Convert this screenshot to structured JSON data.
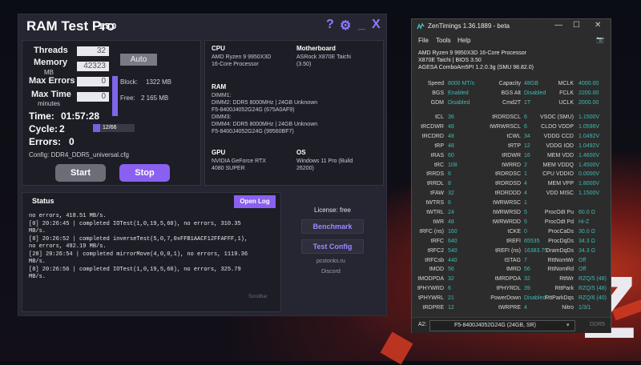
{
  "rtp": {
    "title": "RAM Test Pro",
    "version": "1.5.0",
    "controls": {
      "help": "?",
      "settings": "⚙",
      "minimize": "_",
      "close": "X"
    },
    "threads_label": "Threads",
    "threads_value": "32",
    "memory_label": "Memory",
    "memory_unit": "MB",
    "memory_value": "42323",
    "auto_label": "Auto",
    "max_errors_label": "Max Errors",
    "max_errors_value": "0",
    "max_time_label": "Max Time",
    "max_time_unit": "minutes",
    "max_time_value": "0",
    "block_label": "Block:",
    "block_value": "1322 MB",
    "free_label": "Free:",
    "free_value": "2 165 MB",
    "time_label": "Time:",
    "time_value": "01:57:28",
    "cycle_label": "Cycle:",
    "cycle_value": "2",
    "progress_text": "12/66",
    "progress_fraction": 0.18,
    "errors_label": "Errors:",
    "errors_value": "0",
    "config_text": "Config: DDR4_DDR5_universal.cfg",
    "start_label": "Start",
    "stop_label": "Stop",
    "cpu_h": "CPU",
    "cpu_t": "AMD Ryzen 9 9950X3D\n16-Core Processor",
    "mb_h": "Motherboard",
    "mb_t": "ASRock X870E Taichi\n(3.50)",
    "ram_h": "RAM",
    "ram_t": "DIMM1:\nDIMM2: DDR5 8000MHz | 24GB Unknown\nF5-8400J4052G24G (675A0AF9)\nDIMM3:\nDIMM4: DDR5 8000MHz | 24GB Unknown\nF5-8400J4052G24G (99560BF7)",
    "gpu_h": "GPU",
    "gpu_t": "NVIDIA GeForce RTX\n4080 SUPER",
    "os_h": "OS",
    "os_t": "Windows 11 Pro (Build\n26200)",
    "status_label": "Status",
    "openlog_label": "Open Log",
    "log": "no errors, 418.51 MB/s.\n[0] 20:26:45 | completed IOTest(1,0,19,5,60), no errors, 310.35\nMB/s.\n[8] 20:26:52 | completed inverseTest(5,0,7,0xFFB1AACF12FFAFFF,1),\nno errors, 492.19 MB/s.\n[28] 20:26:54 | completed mirrorMove(4,0,0,1), no errors, 1119.36\nMB/s.\n[8] 20:26:56 | completed IOTest(1,0,19,5,60), no errors, 325.79\nMB/s.",
    "scrollbar_label": "Scrollbar",
    "license": "License: free",
    "benchmark_label": "Benchmark",
    "testconfig_label": "Test Config",
    "link1": "pcstonks.ru",
    "link2": "Discord"
  },
  "zt": {
    "title": "ZenTimings 1.36.1889 - beta",
    "menu": [
      "File",
      "Tools",
      "Help"
    ],
    "info": "AMD Ryzen 9 9950X3D 16-Core Processor\nX870E Taichi | BIOS 3.50\nAGESA ComboAm5PI 1.2.0.3g (SMU 98.82.0)",
    "top": [
      [
        "Speed",
        "8000 MT/s",
        "Capacity",
        "48GB",
        "MCLK",
        "4000.00"
      ],
      [
        "BGS",
        "Enabled",
        "BGS Alt",
        "Disabled",
        "FCLK",
        "2200.00"
      ],
      [
        "GDM",
        "Disabled",
        "Cmd2T",
        "1T",
        "UCLK",
        "2000.00"
      ]
    ],
    "rows": [
      [
        "tCL",
        "36",
        "tRDRDSCL",
        "6",
        "VSOC (SMU)",
        "1.1500V"
      ],
      [
        "tRCDWR",
        "48",
        "tWRWRSCL",
        "6",
        "CLDO VDDP",
        "1.0596V"
      ],
      [
        "tRCDRD",
        "48",
        "tCWL",
        "34",
        "VDDG CCD",
        "1.0492V"
      ],
      [
        "tRP",
        "48",
        "tRTP",
        "12",
        "VDDG IOD",
        "1.0492V"
      ],
      [
        "tRAS",
        "60",
        "tRDWR",
        "16",
        "MEM VDD",
        "1.4600V"
      ],
      [
        "tRC",
        "108",
        "tWRRD",
        "2",
        "MEM VDDQ",
        "1.4500V"
      ],
      [
        "tRRDS",
        "6",
        "tRDRDSC",
        "1",
        "CPU VDDIO",
        "0.0000V"
      ],
      [
        "tRRDL",
        "8",
        "tRDRDSD",
        "4",
        "MEM VPP",
        "1.8000V"
      ],
      [
        "tFAW",
        "32",
        "tRDRDDD",
        "4",
        "VDD MISC",
        "1.1500V"
      ],
      [
        "tWTRS",
        "6",
        "tWRWRSC",
        "1",
        "",
        ""
      ],
      [
        "tWTRL",
        "24",
        "tWRWRSD",
        "5",
        "ProcOdt Pu",
        "60.0 Ω"
      ],
      [
        "tWR",
        "48",
        "tWRWRDD",
        "5",
        "ProcOdt Pd",
        "Hi-Z"
      ],
      [
        "tRFC (ns)",
        "160",
        "tCKE",
        "0",
        "ProcCaDs",
        "30.0 Ω"
      ],
      [
        "tRFC",
        "640",
        "tREFI",
        "65535",
        "ProcDqDs",
        "34.3 Ω"
      ],
      [
        "tRFC2",
        "540",
        "tREFI (ns)",
        "16383.75",
        "DramDqDs",
        "34.3 Ω"
      ],
      [
        "tRFCsb",
        "440",
        "tSTAG",
        "7",
        "RttNomWr",
        "Off"
      ],
      [
        "tMOD",
        "56",
        "tMRD",
        "56",
        "RttNomRd",
        "Off"
      ],
      [
        "tMODPDA",
        "32",
        "tMRDPDA",
        "32",
        "RttWr",
        "RZQ/5 (48)"
      ],
      [
        "tPHYWRD",
        "6",
        "tPHYRDL",
        "39",
        "RttPark",
        "RZQ/5 (48)"
      ],
      [
        "tPHYWRL",
        "21",
        "PowerDown",
        "Disabled",
        "RttParkDqs",
        "RZQ/6 (40)"
      ],
      [
        "tRDPRE",
        "12",
        "tWRPRE",
        "4",
        "Nitro",
        "1/3/1"
      ]
    ],
    "slot": "A2:",
    "module": "F5-8400J4052G24G (24GB, SR)",
    "ddr": "DDR5"
  },
  "colors": {
    "accent": "#8c7bff",
    "zt_value": "#3fbab2"
  }
}
